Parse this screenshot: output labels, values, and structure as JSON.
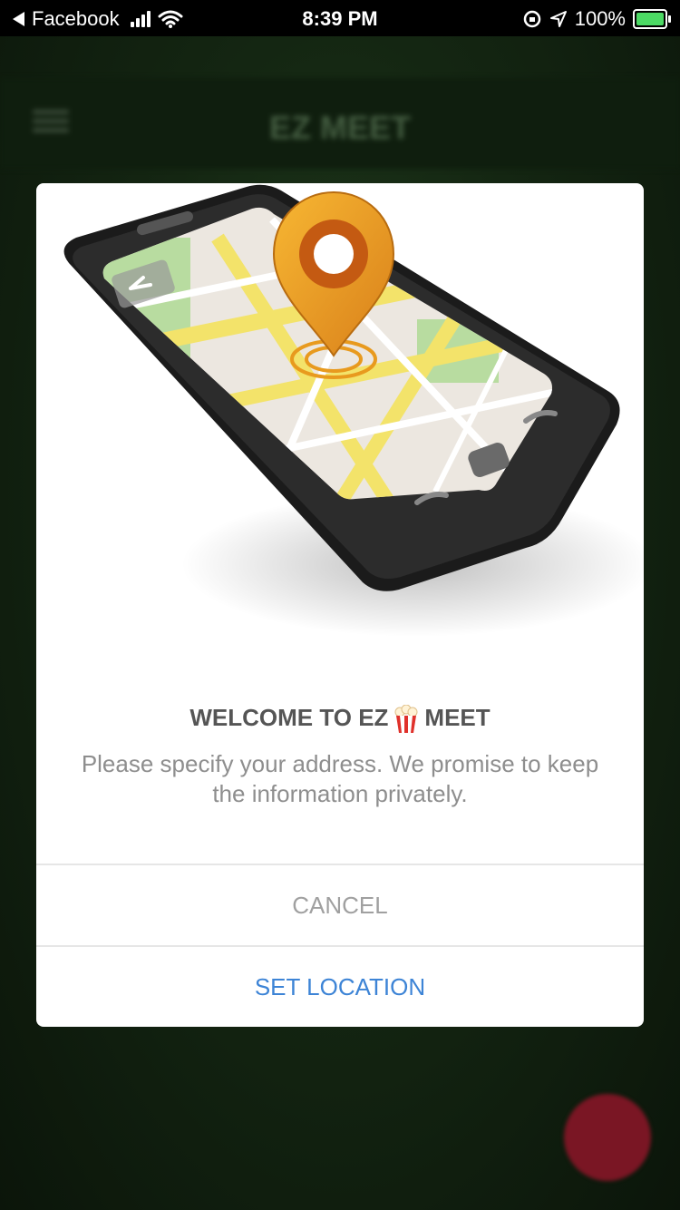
{
  "status_bar": {
    "back_app": "Facebook",
    "time": "8:39 PM",
    "battery": "100%"
  },
  "app_header": {
    "title": "EZ MEET"
  },
  "modal": {
    "title_before": "WELCOME TO EZ",
    "title_after": "MEET",
    "message": "Please specify your address. We promise to keep the information privately.",
    "cancel_label": "CANCEL",
    "set_location_label": "SET LOCATION"
  },
  "colors": {
    "accent": "#3d84d6",
    "battery": "#4cd964",
    "pin": "#e89a1e"
  }
}
